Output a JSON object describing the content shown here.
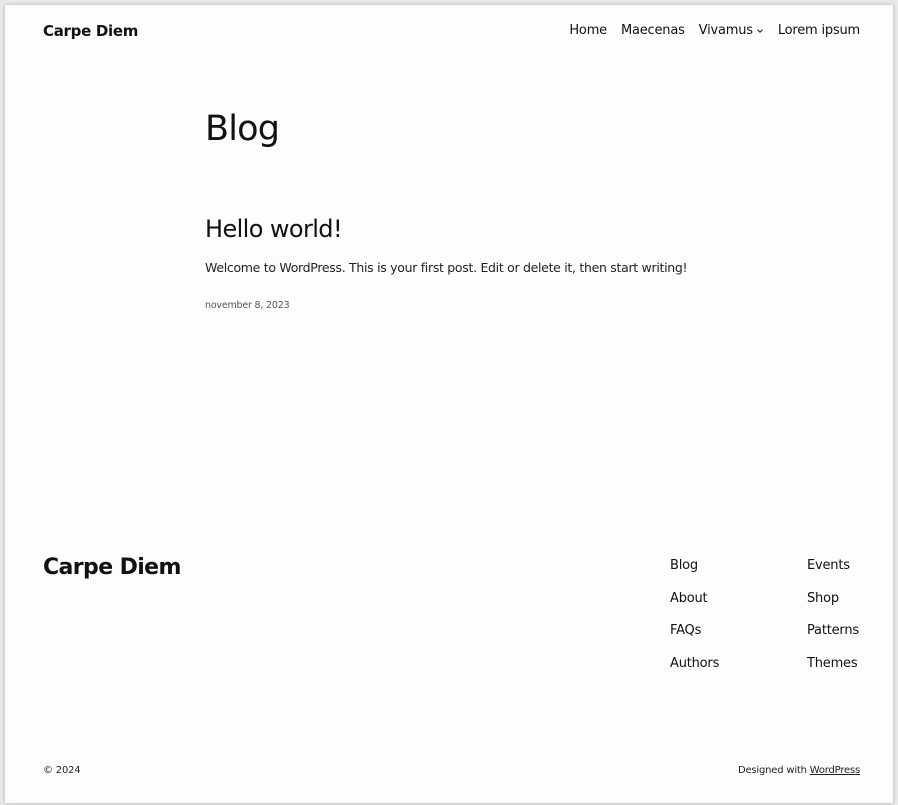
{
  "header": {
    "site_title": "Carpe Diem",
    "nav": [
      {
        "label": "Home"
      },
      {
        "label": "Maecenas"
      },
      {
        "label": "Vivamus",
        "has_submenu": true
      },
      {
        "label": "Lorem ipsum"
      }
    ]
  },
  "main": {
    "page_title": "Blog",
    "posts": [
      {
        "title": "Hello world!",
        "excerpt": "Welcome to WordPress. This is your first post. Edit or delete it, then start writing!",
        "date": "november 8, 2023"
      }
    ]
  },
  "footer": {
    "site_title": "Carpe Diem",
    "col1": [
      "Blog",
      "About",
      "FAQs",
      "Authors"
    ],
    "col2": [
      "Events",
      "Shop",
      "Patterns",
      "Themes"
    ],
    "copyright": "© 2024",
    "credit_prefix": "Designed with",
    "credit_link": "WordPress"
  },
  "icons": {
    "submenu": "chevron-down-icon"
  }
}
